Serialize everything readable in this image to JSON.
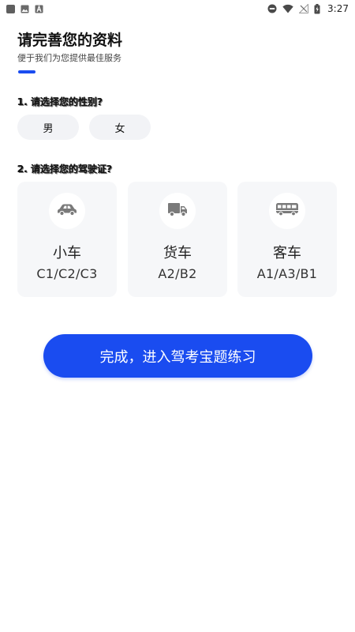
{
  "status_bar": {
    "time": "3:27",
    "icons": [
      "app-square-icon",
      "image-icon",
      "font-a-icon",
      "do-not-disturb-icon",
      "wifi-icon",
      "no-signal-icon",
      "battery-icon"
    ]
  },
  "header": {
    "title": "请完善您的资料",
    "subtitle": "便于我们为您提供最佳服务",
    "accent_color": "#1a4cf0"
  },
  "gender_question": {
    "label": "1. 请选择您的性别?",
    "options": [
      {
        "label": "男"
      },
      {
        "label": "女"
      }
    ]
  },
  "license_question": {
    "label": "2. 请选择您的驾驶证?",
    "options": [
      {
        "name": "小车",
        "classes": "C1/C2/C3",
        "icon": "car-icon"
      },
      {
        "name": "货车",
        "classes": "A2/B2",
        "icon": "truck-icon"
      },
      {
        "name": "客车",
        "classes": "A1/A3/B1",
        "icon": "bus-icon"
      }
    ]
  },
  "submit": {
    "label": "完成，进入驾考宝题练习"
  }
}
